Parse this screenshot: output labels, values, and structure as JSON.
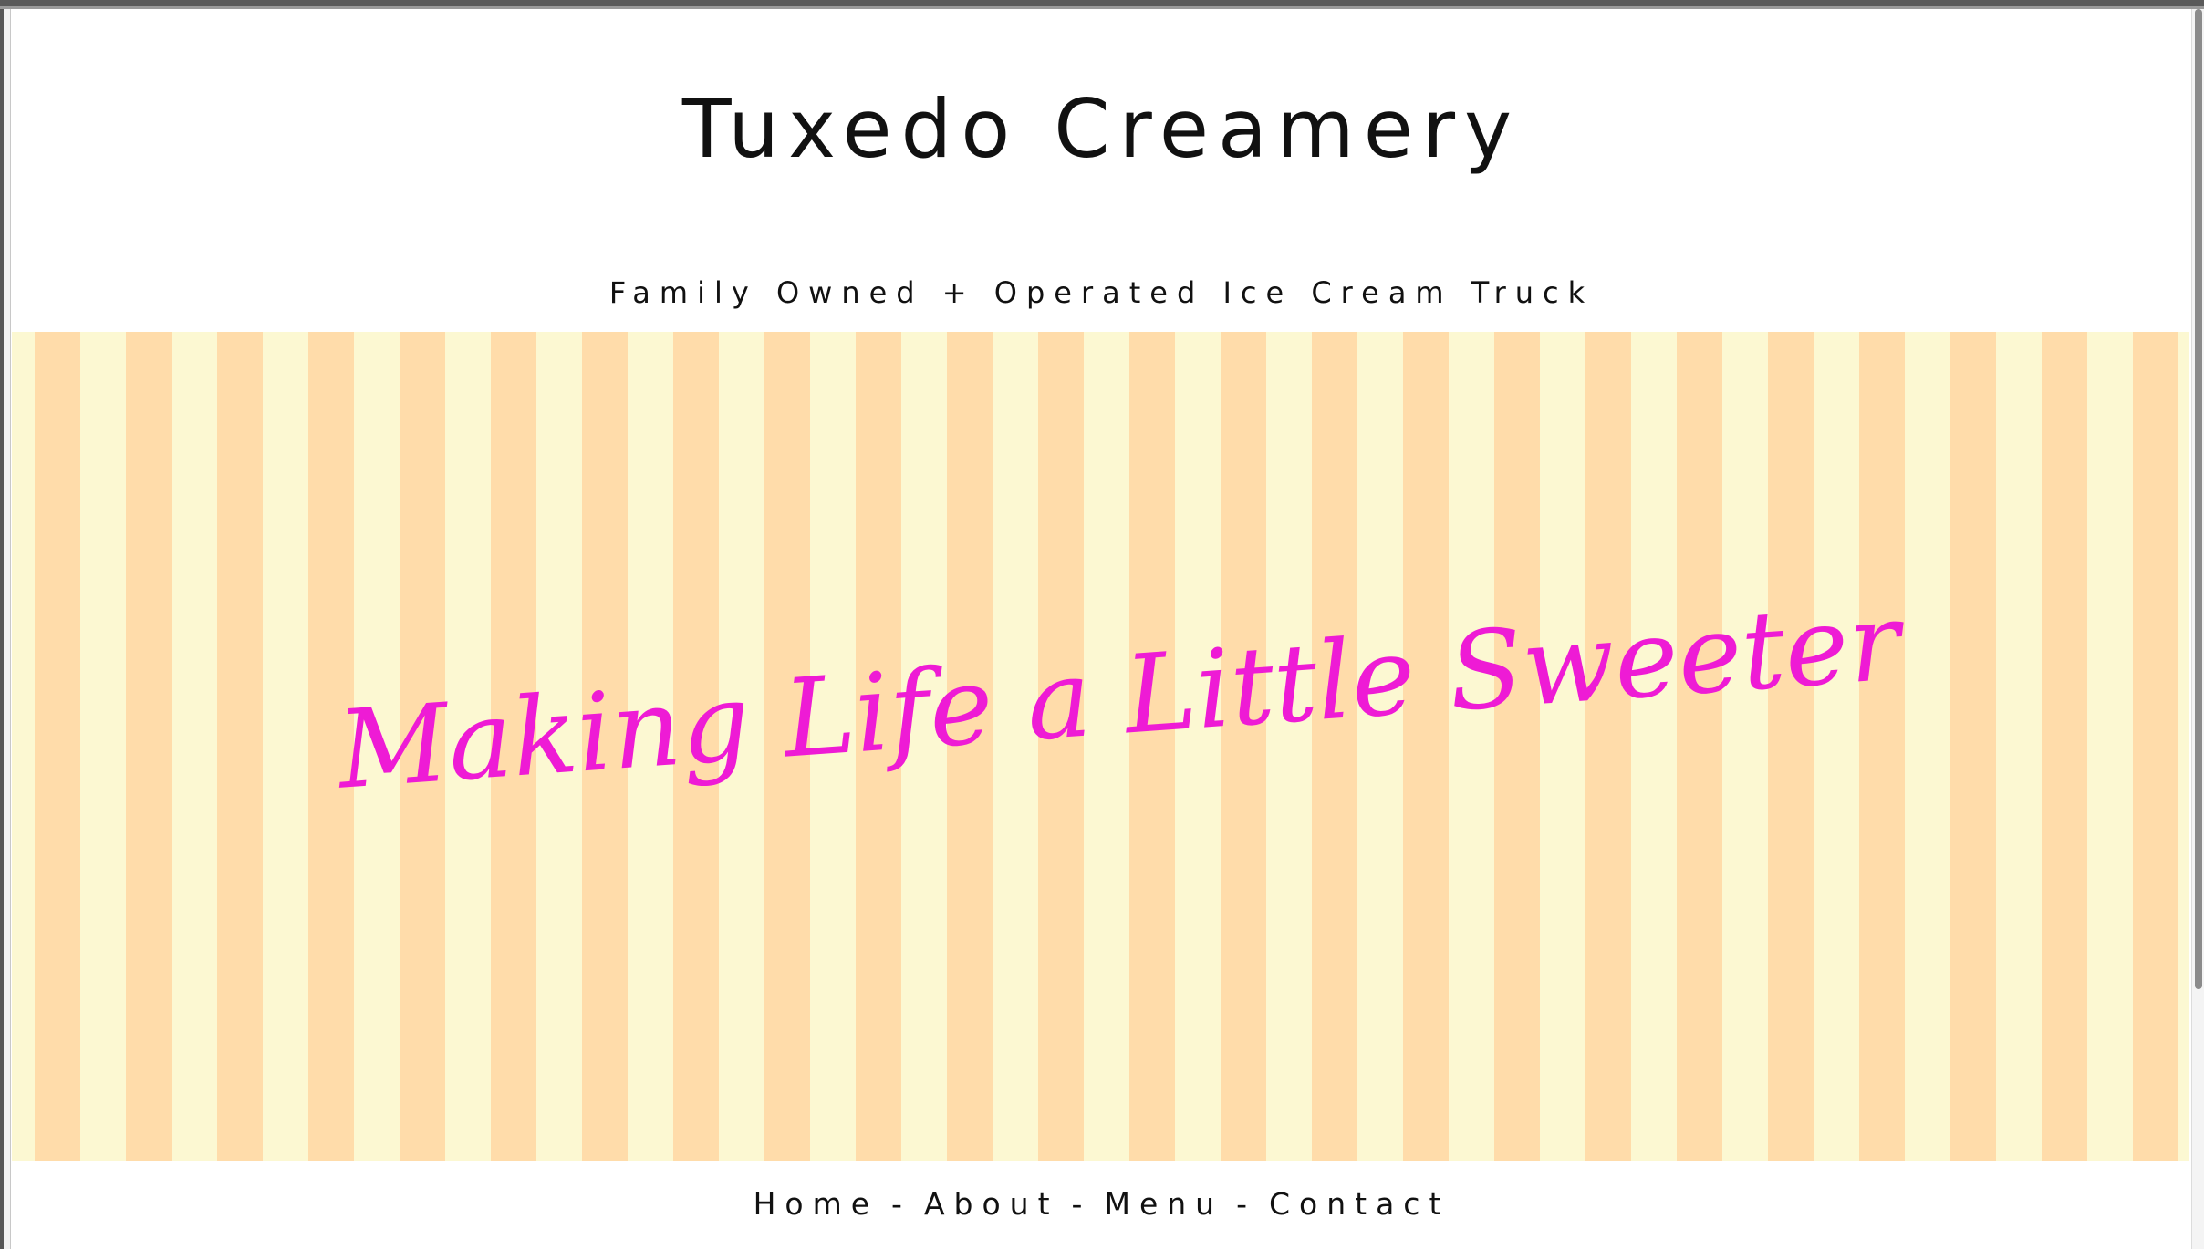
{
  "site": {
    "title": "Tuxedo Creamery",
    "tagline": "Family Owned + Operated Ice Cream Truck"
  },
  "hero": {
    "headline": "Making Life a Little Sweeter",
    "colors": {
      "headline": "#ee1bd5",
      "stripe_light": "#fcf8d2",
      "stripe_dark": "#ffdcaa"
    }
  },
  "nav": {
    "items": [
      {
        "label": "Home"
      },
      {
        "label": "About"
      },
      {
        "label": "Menu"
      },
      {
        "label": "Contact"
      }
    ],
    "separator": "-"
  }
}
